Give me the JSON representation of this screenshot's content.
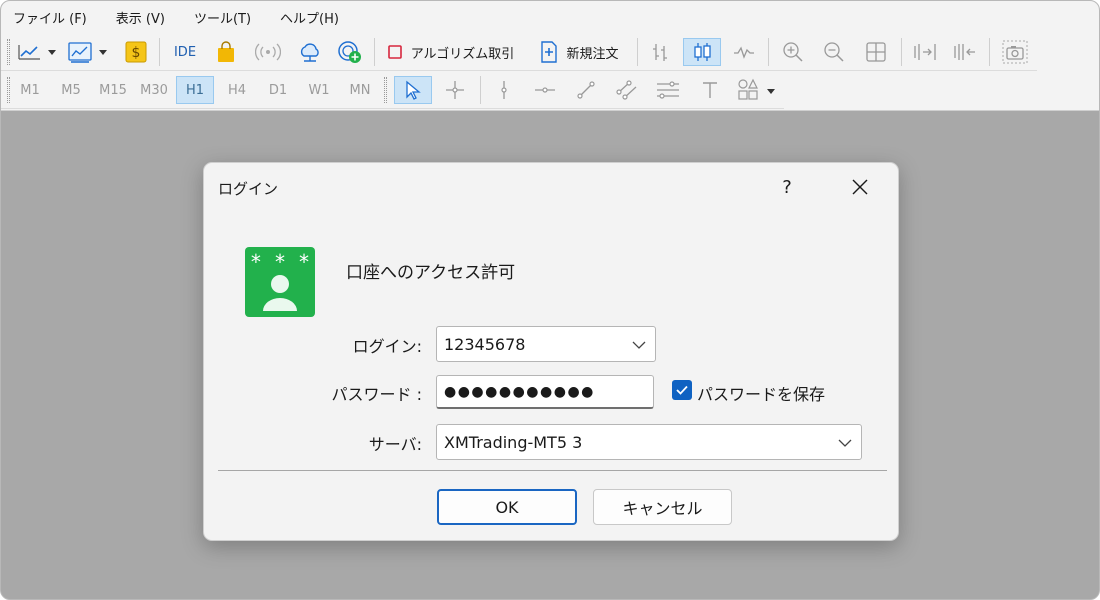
{
  "menu": [
    "ファイル (F)",
    "表示 (V)",
    "ツール(T)",
    "ヘルプ(H)"
  ],
  "toolbar": {
    "ide_label": "IDE",
    "algo_label": "アルゴリズム取引",
    "new_order_label": "新規注文",
    "timeframes": [
      "M1",
      "M5",
      "M15",
      "M30",
      "H1",
      "H4",
      "D1",
      "W1",
      "MN"
    ],
    "active_timeframe": "H1"
  },
  "dialog": {
    "title": "ログイン",
    "help_symbol": "?",
    "heading": "口座へのアクセス許可",
    "login_label": "ログイン:",
    "login_value": "12345678",
    "password_label": "パスワード :",
    "password_mask": "●●●●●●●●●●●",
    "save_password_label": "パスワードを保存",
    "save_password_checked": true,
    "server_label": "サーバ:",
    "server_value": "XMTrading-MT5 3",
    "ok_label": "OK",
    "cancel_label": "キャンセル",
    "icon_stars": "* * *"
  },
  "colors": {
    "accent": "#0f62c2",
    "icon_green": "#22b14c",
    "workspace": "#a8a8a8",
    "active_tool": "#cce4f7"
  }
}
